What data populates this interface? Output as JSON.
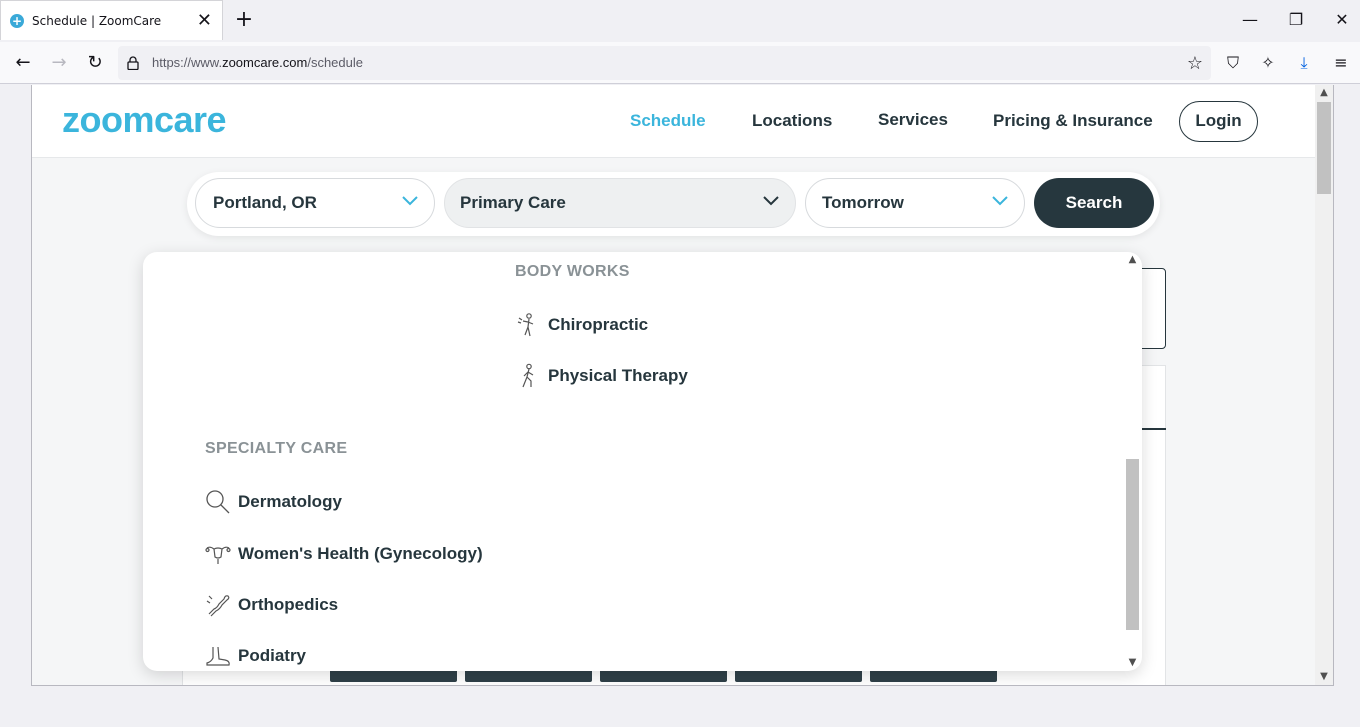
{
  "browser": {
    "tab_title": "Schedule | ZoomCare",
    "url_prefix": "https://www.",
    "url_domain": "zoomcare.com",
    "url_path": "/schedule"
  },
  "site": {
    "logo": "zoomcare",
    "nav": {
      "schedule": "Schedule",
      "locations": "Locations",
      "services": "Services",
      "pricing": "Pricing & Insurance",
      "login": "Login"
    },
    "colors": {
      "brand": "#3bb5dc",
      "dark": "#26373e"
    }
  },
  "search": {
    "location": "Portland, OR",
    "service": "Primary Care",
    "date": "Tomorrow",
    "button": "Search"
  },
  "dropdown": {
    "body_works": {
      "title": "BODY WORKS",
      "items": [
        {
          "label": "Chiropractic",
          "icon": "chiropractic-icon"
        },
        {
          "label": "Physical Therapy",
          "icon": "physical-therapy-icon"
        }
      ]
    },
    "specialty_care": {
      "title": "SPECIALTY CARE",
      "items": [
        {
          "label": "Dermatology",
          "icon": "magnifier-icon"
        },
        {
          "label": "Women's Health (Gynecology)",
          "icon": "uterus-icon"
        },
        {
          "label": "Orthopedics",
          "icon": "bone-icon"
        },
        {
          "label": "Podiatry",
          "icon": "foot-icon"
        }
      ]
    }
  }
}
